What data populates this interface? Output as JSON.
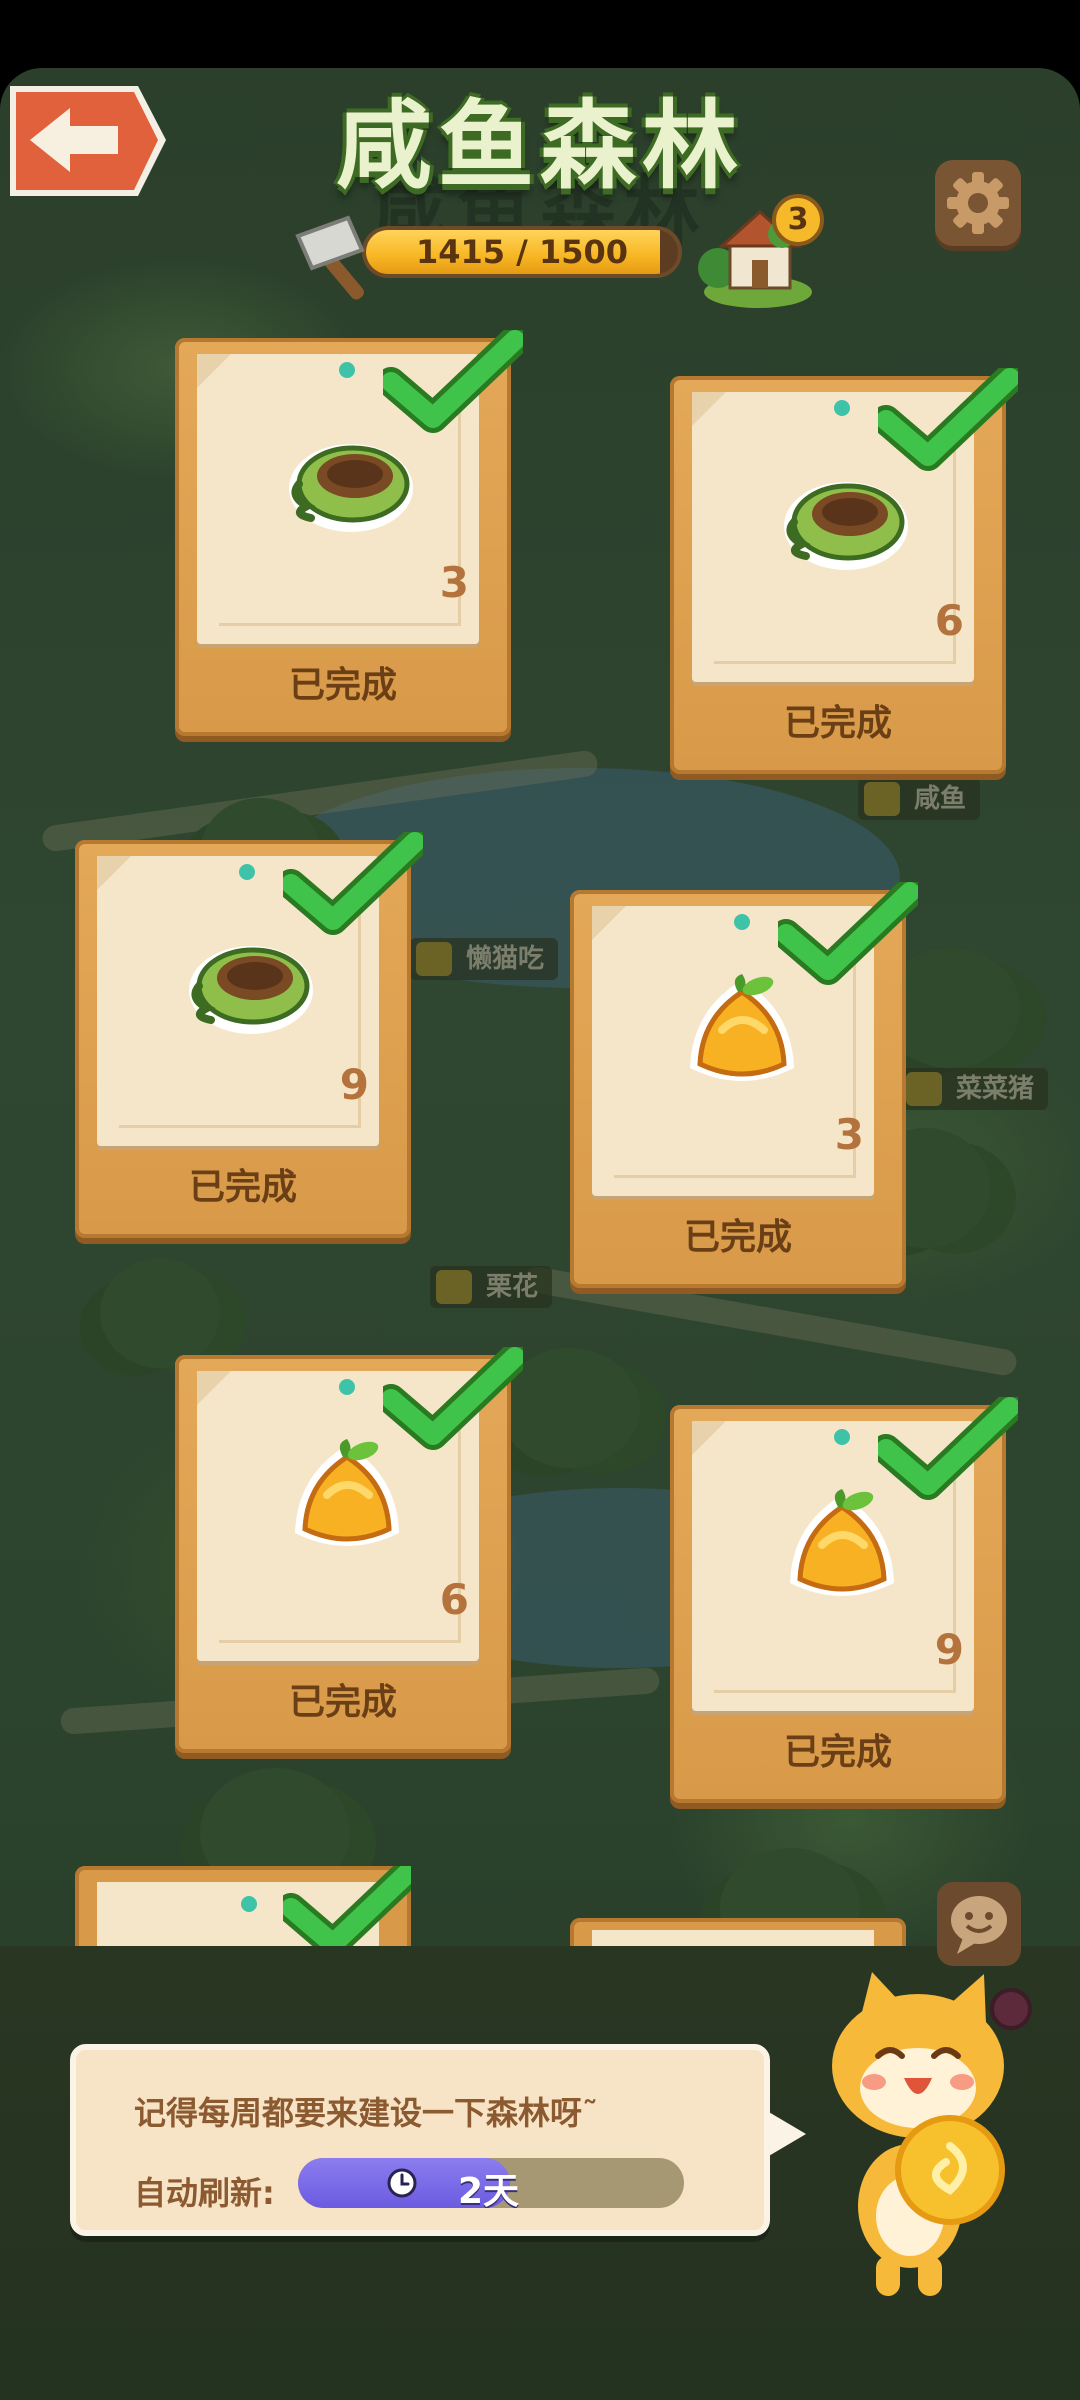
{
  "header": {
    "title": "咸鱼森林",
    "progress": {
      "current": 1415,
      "max": 1500,
      "text": "1415 / 1500"
    },
    "level_badge": "3",
    "icons": {
      "back": "back-arrow-icon",
      "settings": "gear-icon",
      "hammer": "hammer-icon",
      "house": "house-icon"
    }
  },
  "map_labels": [
    "懒猫吃",
    "菜菜猪",
    "栗花",
    "咸鱼"
  ],
  "tasks": [
    {
      "item": "nest",
      "count": "3",
      "status": "已完成"
    },
    {
      "item": "nest",
      "count": "6",
      "status": "已完成"
    },
    {
      "item": "nest",
      "count": "9",
      "status": "已完成"
    },
    {
      "item": "fruit",
      "count": "3",
      "status": "已完成"
    },
    {
      "item": "fruit",
      "count": "6",
      "status": "已完成"
    },
    {
      "item": "fruit",
      "count": "9",
      "status": "已完成"
    }
  ],
  "footer": {
    "tip": "记得每周都要来建设一下森林呀˜",
    "refresh_label": "自动刷新:",
    "refresh_value": "2天",
    "refresh_progress": 0.55,
    "icons": {
      "chat": "chat-icon",
      "clock": "clock-icon",
      "mascot": "cat-mascot"
    }
  },
  "colors": {
    "accent_green": "#3fc34a",
    "wood": "#d89a49",
    "paper": "#f6e6c9",
    "refresh_fill": "#7a6be8"
  }
}
